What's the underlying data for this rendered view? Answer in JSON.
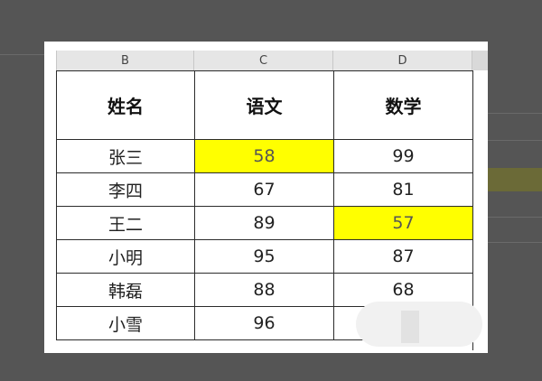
{
  "columns": {
    "b": "B",
    "c": "C",
    "d": "D"
  },
  "table": {
    "headers": [
      "姓名",
      "语文",
      "数学"
    ],
    "rows": [
      {
        "name": "张三",
        "chinese": "58",
        "math": "99"
      },
      {
        "name": "李四",
        "chinese": "67",
        "math": "81"
      },
      {
        "name": "王二",
        "chinese": "89",
        "math": "57"
      },
      {
        "name": "小明",
        "chinese": "95",
        "math": "87"
      },
      {
        "name": "韩磊",
        "chinese": "88",
        "math": "68"
      },
      {
        "name": "小雪",
        "chinese": "96",
        "math": ""
      }
    ]
  },
  "highlight_color": "#ffff00"
}
